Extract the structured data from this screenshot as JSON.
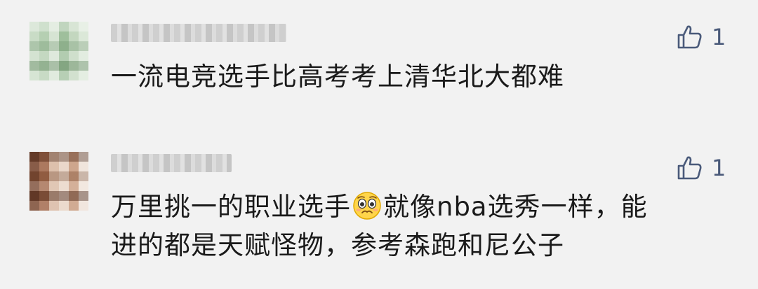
{
  "comments": [
    {
      "text": "一流电竞选手比高考考上清华北大都难",
      "likes": "1",
      "avatar_icon": "pixelated-avatar-icon",
      "like_icon": "thumbs-up-outline-icon"
    },
    {
      "text_line1_a": "万里挑一的职业选手",
      "emoji_icon": "pleading-face-emoji-icon",
      "text_line1_b": "就像nba选秀一样，能",
      "text_line2": "进的都是天赋怪物，参考森跑和尼公子",
      "likes": "1",
      "avatar_icon": "pixelated-avatar-icon",
      "like_icon": "thumbs-up-outline-icon"
    }
  ],
  "colors": {
    "background": "#f2f2f2",
    "text": "#1a1a1a",
    "like_icon": "#4a5a7a"
  }
}
